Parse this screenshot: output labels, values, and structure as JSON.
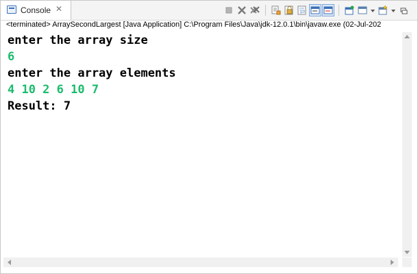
{
  "tab": {
    "label": "Console",
    "close_glyph": "✕"
  },
  "toolbar": {
    "icons": [
      "terminate-icon",
      "remove-launch-icon",
      "remove-all-terminated-icon",
      "clear-console-icon",
      "scroll-lock-icon",
      "word-wrap-icon",
      "show-console-on-stdout-icon",
      "show-console-on-stderr-icon",
      "pin-console-icon",
      "display-selected-console-icon",
      "open-console-icon",
      "minimize-icon"
    ],
    "accent": "#3b6fb6"
  },
  "status": {
    "text": "<terminated> ArraySecondLargest [Java Application] C:\\Program Files\\Java\\jdk-12.0.1\\bin\\javaw.exe (02-Jul-202"
  },
  "console": {
    "lines": [
      {
        "text": "enter the array size",
        "kind": "output"
      },
      {
        "text": "6",
        "kind": "input"
      },
      {
        "text": "enter the array elements",
        "kind": "output"
      },
      {
        "text": "4 10 2 6 10 7",
        "kind": "input"
      },
      {
        "text": "Result: 7",
        "kind": "output"
      }
    ],
    "input_color": "#1abc6c",
    "output_color": "#000000"
  }
}
